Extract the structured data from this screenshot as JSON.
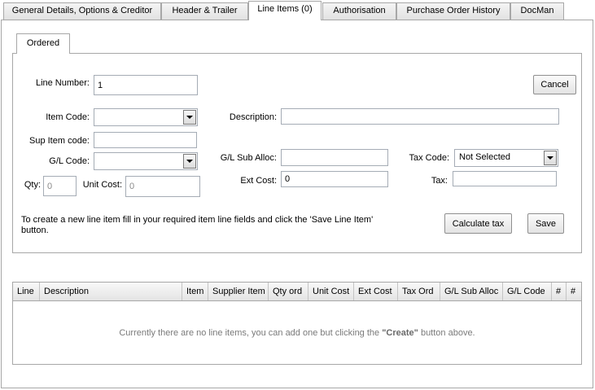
{
  "tabs": [
    {
      "label": "General Details, Options & Creditor",
      "active": false
    },
    {
      "label": "Header & Trailer",
      "active": false
    },
    {
      "label": "Line Items (0)",
      "active": true
    },
    {
      "label": "Authorisation",
      "active": false
    },
    {
      "label": "Purchase Order History",
      "active": false
    },
    {
      "label": "DocMan",
      "active": false
    }
  ],
  "inner_tab": {
    "label": "Ordered"
  },
  "form": {
    "line_number": {
      "label": "Line Number:",
      "value": "1"
    },
    "item_code": {
      "label": "Item Code:",
      "value": ""
    },
    "sup_item_code": {
      "label": "Sup Item code:",
      "value": ""
    },
    "gl_code": {
      "label": "G/L Code:",
      "value": ""
    },
    "qty": {
      "label": "Qty:",
      "value": "0"
    },
    "unit_cost": {
      "label": "Unit Cost:",
      "value": "0"
    },
    "description": {
      "label": "Description:",
      "value": ""
    },
    "gl_sub_alloc": {
      "label": "G/L Sub Alloc:",
      "value": ""
    },
    "ext_cost": {
      "label": "Ext Cost:",
      "value": "0"
    },
    "tax_code": {
      "label": "Tax Code:",
      "value": "Not Selected"
    },
    "tax": {
      "label": "Tax:",
      "value": ""
    }
  },
  "buttons": {
    "cancel": "Cancel",
    "calculate_tax": "Calculate tax",
    "save": "Save"
  },
  "help_text": "To create a new line item fill in your required item line fields and click the 'Save Line Item' button.",
  "grid": {
    "columns": [
      "Line",
      "Description",
      "Item",
      "Supplier Item",
      "Qty ord",
      "Unit Cost",
      "Ext Cost",
      "Tax Ord",
      "G/L Sub Alloc",
      "G/L Code",
      "#",
      "#"
    ],
    "empty_before": "Currently there are no line items, you can add one but clicking the ",
    "empty_bold": "\"Create\"",
    "empty_after": " button above."
  },
  "icons": {
    "dropdown": "chevron-down-icon"
  }
}
